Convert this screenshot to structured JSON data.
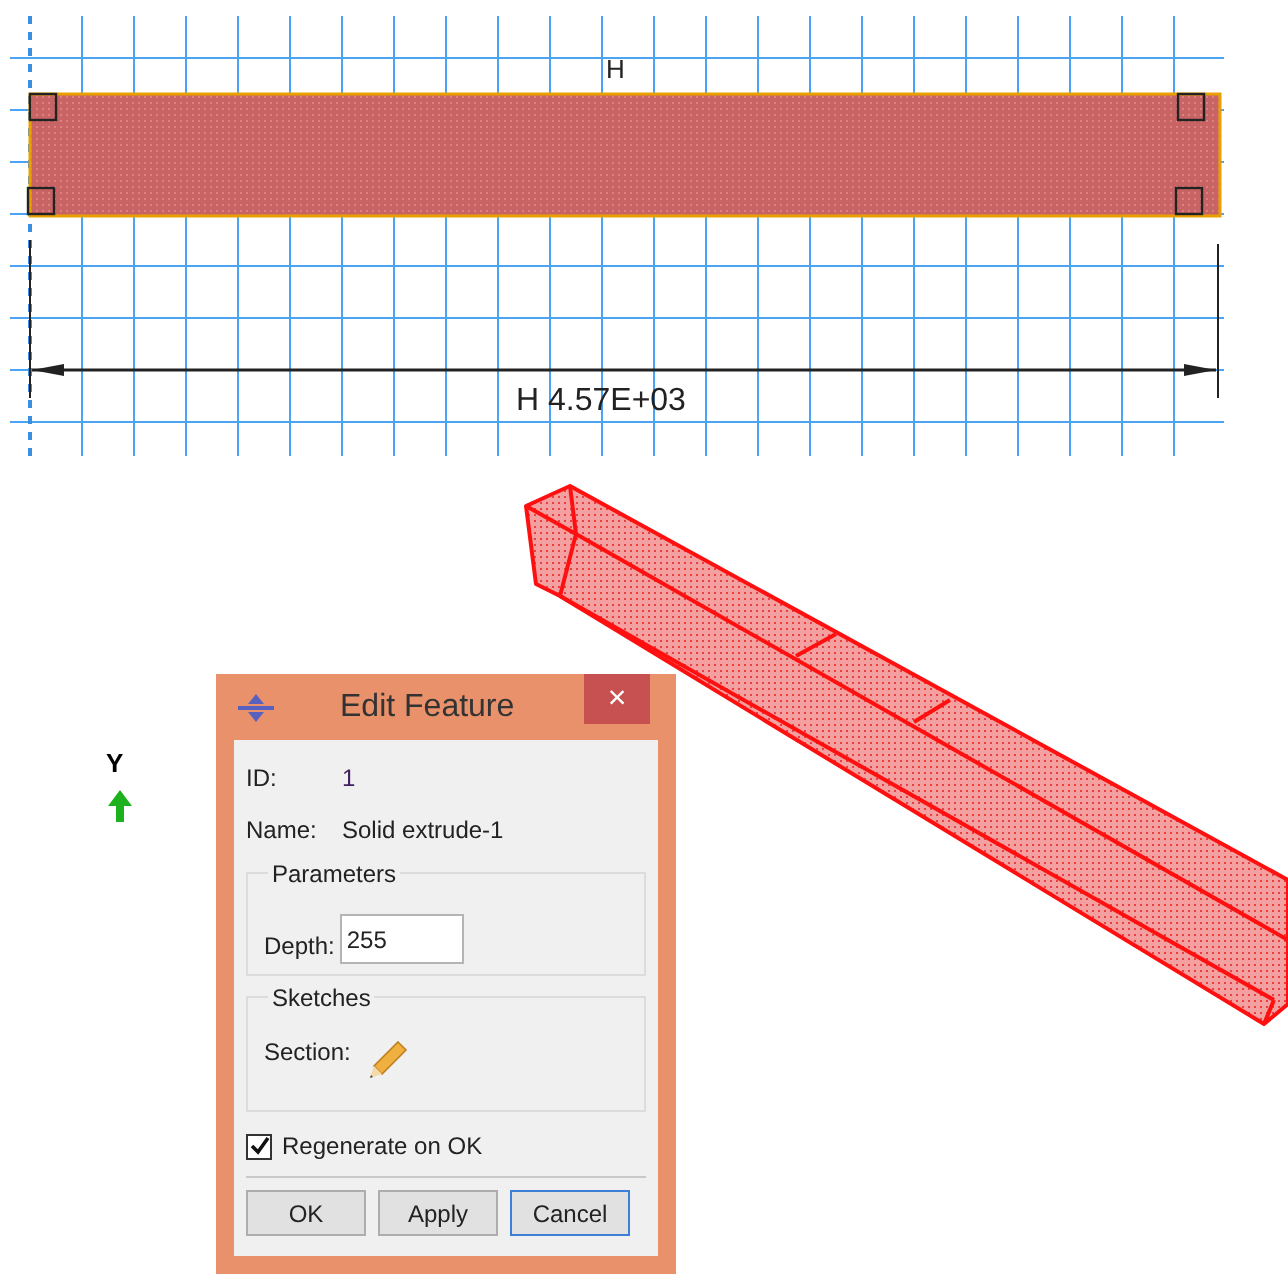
{
  "sketch": {
    "dimension_name": "H",
    "dimension_label": "H 4.57E+03"
  },
  "axis": {
    "label": "Y"
  },
  "dialog": {
    "title": "Edit Feature",
    "close": "×",
    "fields": [
      {
        "label": "ID:",
        "value": "1"
      },
      {
        "label": "Name:",
        "value": "Solid extrude-1"
      }
    ],
    "parameters": {
      "title": "Parameters",
      "label": "Depth:",
      "value": "255"
    },
    "sketches": {
      "title": "Sketches",
      "label": "Section:"
    },
    "regenerate": {
      "label": "Regenerate on OK",
      "checked": true
    },
    "buttons": [
      {
        "label": "OK",
        "focused": false
      },
      {
        "label": "Apply",
        "focused": false
      },
      {
        "label": "Cancel",
        "focused": true
      }
    ]
  }
}
